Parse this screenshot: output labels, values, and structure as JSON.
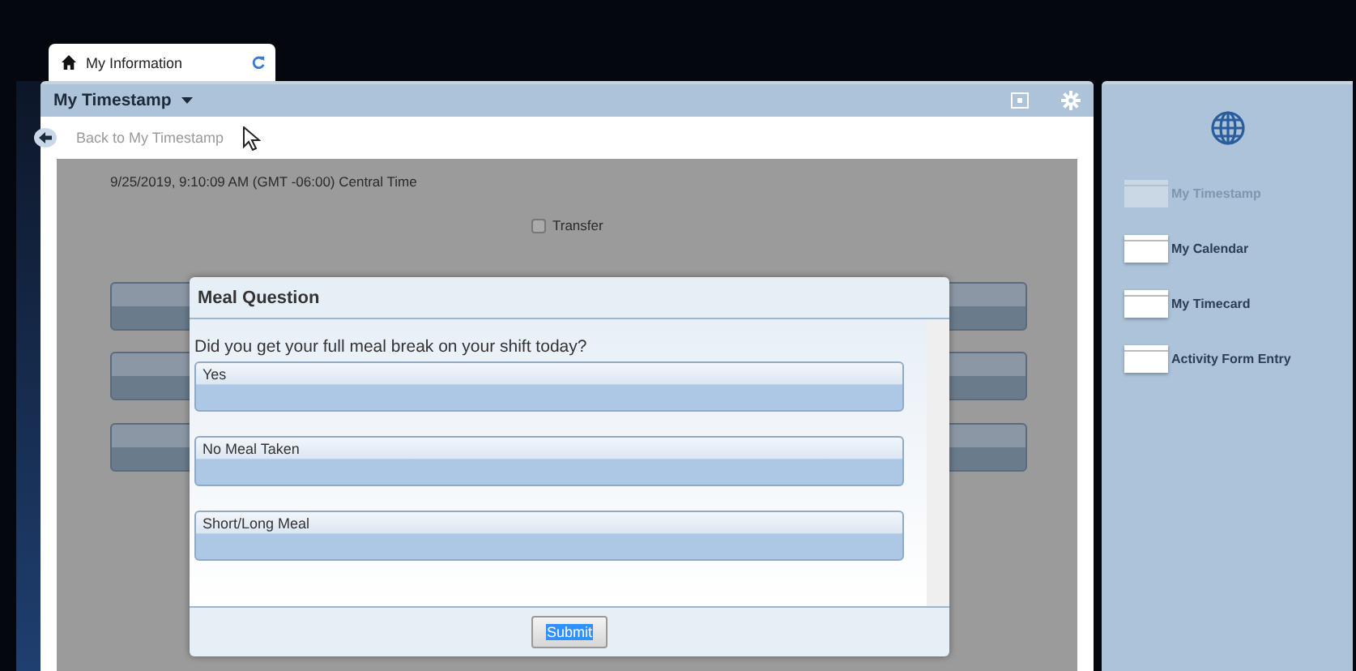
{
  "tab": {
    "label": "My Information"
  },
  "panel": {
    "title": "My Timestamp",
    "back_link": "Back to My Timestamp",
    "timestamp": "9/25/2019, 9:10:09 AM (GMT -06:00) Central Time",
    "transfer": {
      "label": "Transfer",
      "checked": false
    }
  },
  "dialog": {
    "title": "Meal Question",
    "question": "Did you get your full meal break on your shift today?",
    "options": [
      {
        "label": "Yes"
      },
      {
        "label": "No Meal Taken"
      },
      {
        "label": "Short/Long Meal"
      }
    ],
    "submit": {
      "label": "Submit",
      "highlighted": true
    }
  },
  "sidebar": {
    "items": [
      {
        "label": "My Timestamp",
        "disabled": true
      },
      {
        "label": "My Calendar",
        "disabled": false
      },
      {
        "label": "My Timecard",
        "disabled": false
      },
      {
        "label": "Activity Form Entry",
        "disabled": false
      }
    ]
  }
}
